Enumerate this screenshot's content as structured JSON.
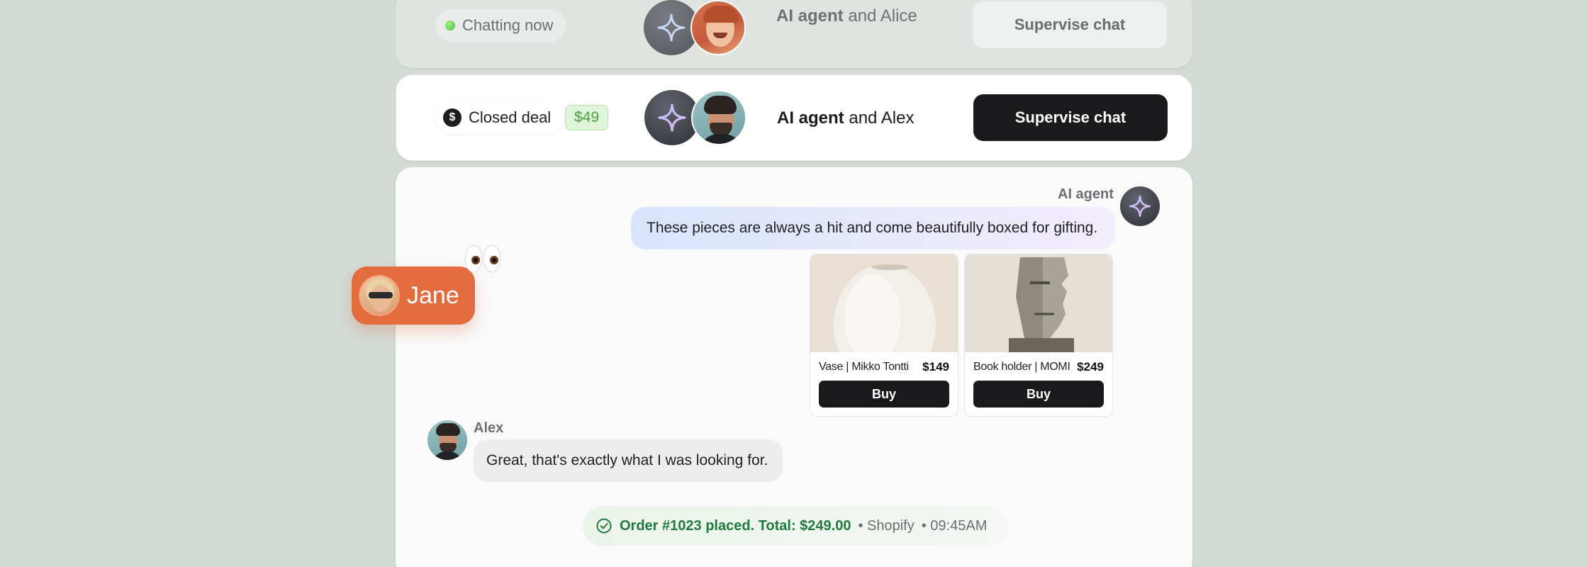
{
  "chats": [
    {
      "status": "Chatting now",
      "agent": "AI agent",
      "connector": "and",
      "customer": "Alice",
      "action": "Supervise chat"
    },
    {
      "status": "Closed deal",
      "deal_value": "$49",
      "agent": "AI agent",
      "connector": "and",
      "customer": "Alex",
      "action": "Supervise chat"
    }
  ],
  "conversation": {
    "ai_sender": "AI agent",
    "ai_message": "These pieces are always a hit and come beautifully boxed for gifting.",
    "products": [
      {
        "name": "Vase | Mikko Tontti",
        "price": "$149",
        "action": "Buy"
      },
      {
        "name": "Book holder | MOMI",
        "price": "$249",
        "action": "Buy"
      }
    ],
    "user_sender": "Alex",
    "user_message": "Great, that's exactly what I was looking for.",
    "order": {
      "main": "Order #1023 placed. Total: $249.00",
      "source": "• Shopify",
      "time": "• 09:45AM"
    }
  },
  "observer": {
    "name": "Jane"
  },
  "colors": {
    "background": "#d3dbd5",
    "primary_button": "#1a1a1c",
    "observer_accent": "#e36c3f",
    "success_text": "#1f7a3e",
    "deal_value_text": "#4ea146"
  },
  "icons": {
    "status_live": "green-dot-icon",
    "closed_deal": "dollar-icon",
    "ai_agent": "sparkle-icon",
    "order_status": "check-circle-icon",
    "observer": "eyes-icon"
  }
}
